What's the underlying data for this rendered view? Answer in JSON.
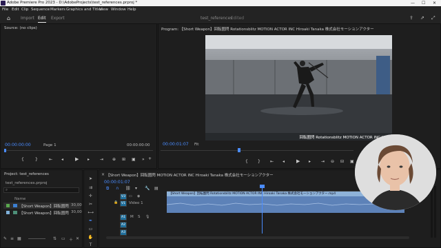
{
  "app": {
    "title": "Adobe Premiere Pro 2023 - D:\\AdobeProjects\\test_references.prproj *"
  },
  "menu": [
    "File",
    "Edit",
    "Clip",
    "Sequence",
    "Markers",
    "Graphics and Titles",
    "View",
    "Window",
    "Help"
  ],
  "workspace": {
    "tabs": [
      "Import",
      "Edit",
      "Export"
    ],
    "active_tab": "Edit",
    "project_name": "test_references",
    "status": "Edited"
  },
  "source": {
    "title": "Source: (no clips)",
    "timecode_left": "00:00:00:00",
    "timecode_right": "00:00:00:00",
    "page": "Page 1"
  },
  "program": {
    "title": "Program: 【Short Weapon】回転圏閃 Rotationsblitz MOTION ACTOR INC Hiroaki Tanaka 株式会社モーションアクター",
    "timecode": "00:00:01:07",
    "zoom": "Fit",
    "overlay_text": "回転圏閃 Rotationsblitz MOTION ACTOR INC Hiro"
  },
  "project": {
    "title": "Project: test_references",
    "file": "test_references.prproj",
    "column_name": "Name",
    "items": [
      {
        "name": "【Short Weapon】回転圏閃",
        "fps": "30,00"
      },
      {
        "name": "【Short Weapon】回転圏閃",
        "fps": "30,00"
      }
    ]
  },
  "timeline": {
    "sequence_tab": "【Short Weapon】回転圏閃 MOTION ACTOR INC Hiroaki Tanaka 株式会社モーションアクター",
    "timecode": "00:00:01:07",
    "video_track_label": "Video 1",
    "clip_label": "【Short Weapon】回転圏閃 Rotationsblitz MOTION ACTOR INC Hiroaki Tanaka 株式会社モーションアクター.mp4",
    "tracks": {
      "video": [
        "V3",
        "V2",
        "V1"
      ],
      "audio": [
        "A1",
        "A2",
        "A3"
      ],
      "track_flags": [
        "M",
        "S"
      ]
    }
  },
  "colors": {
    "accent_blue": "#4a8cff",
    "clip_video": "#8fb3d9",
    "clip_audio": "#5d82b8",
    "track_target": "#1f6f9c",
    "playhead": "#4a8cff"
  }
}
